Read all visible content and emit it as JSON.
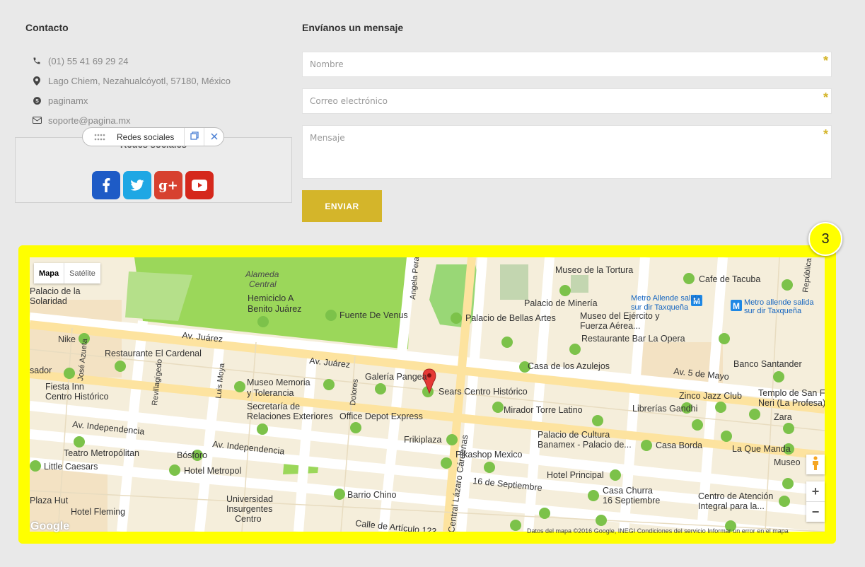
{
  "contact": {
    "title": "Contacto",
    "items": [
      {
        "icon": "phone-icon",
        "text": "(01) 55 41 69 29 24"
      },
      {
        "icon": "map-marker-icon",
        "text": "Lago Chiem, Nezahualcóyotl, 57180, México"
      },
      {
        "icon": "skype-icon",
        "text": "paginamx"
      },
      {
        "icon": "envelope-icon",
        "text": "soporte@pagina.mx"
      }
    ]
  },
  "social": {
    "title": "Redes sociales",
    "toolbar_label": "Redes sociales",
    "networks": [
      {
        "name": "facebook",
        "glyph": "f",
        "color": "#1e5bc6"
      },
      {
        "name": "twitter",
        "glyph": "t",
        "color": "#1ea7e4"
      },
      {
        "name": "google-plus",
        "glyph": "g+",
        "color": "#d7412f"
      },
      {
        "name": "youtube",
        "glyph": "▶",
        "color": "#d5281c"
      }
    ]
  },
  "form": {
    "title": "Envíanos un mensaje",
    "name_placeholder": "Nombre",
    "email_placeholder": "Correo electrónico",
    "message_placeholder": "Mensaje",
    "required_mark": "*",
    "submit_label": "ENVIAR",
    "accent": "#d4b52a"
  },
  "map": {
    "badge": "3",
    "type_map": "Mapa",
    "type_satellite": "Satélite",
    "zoom_in": "+",
    "zoom_out": "−",
    "logo": "Google",
    "attribution": "Datos del mapa ©2016 Google, INEGI   Condiciones del servicio   Informar un error en el mapa",
    "frame_color": "#ffff00",
    "labels": [
      "Alameda Central",
      "Hemiciclo A Benito Juárez",
      "Fuente De Venus",
      "Palacio de Bellas Artes",
      "Museo de la Tortura",
      "Cafe de Tacuba",
      "Palacio de Minería",
      "Metro Allende salida sur dir Taxqueña",
      "Museo del Ejército y Fuerza Aérea...",
      "Restaurante Bar La Opera",
      "Palacio de la Solaridad",
      "Av. Juárez",
      "Nike",
      "Restaurante El Cardenal",
      "Casa de los Azulejos",
      "Banco Santander",
      "Av. 5 de Mayo",
      "Galería Pangea",
      "Sears Centro Histórico",
      "Museo Memoria y Tolerancia",
      "Fiesta Inn Centro Histórico",
      "Secretaría de Relaciones Exteriores",
      "Office Depot Express",
      "Zinco Jazz Club",
      "Templo de San Felipe Neri (La Profesa)",
      "Librerías Gandhi",
      "Mirador Torre Latino",
      "Av. Independencia",
      "Zara",
      "Palacio de Cultura Banamex - Palacio de...",
      "Frikiplaza",
      "Teatro Metropólitan",
      "Bósforo",
      "Pikashop Mexico",
      "Casa Borda",
      "La Que Manda",
      "Little Caesars",
      "Hotel Metropol",
      "Hotel Principal",
      "Casa Churra 16 Septiembre",
      "Universidad Insurgentes Centro",
      "Barrio Chino",
      "16 de Septiembre",
      "Centro de Atención Integral para la...",
      "Hotel Fleming",
      "Central Lázaro Cárdenas",
      "Calle de Artículo 123",
      "Angela Peralta",
      "Luis Moya",
      "Dolores",
      "Revillagigedo",
      "José Azueta",
      "República",
      "Museo",
      "Plaza Hut",
      "sador"
    ]
  }
}
